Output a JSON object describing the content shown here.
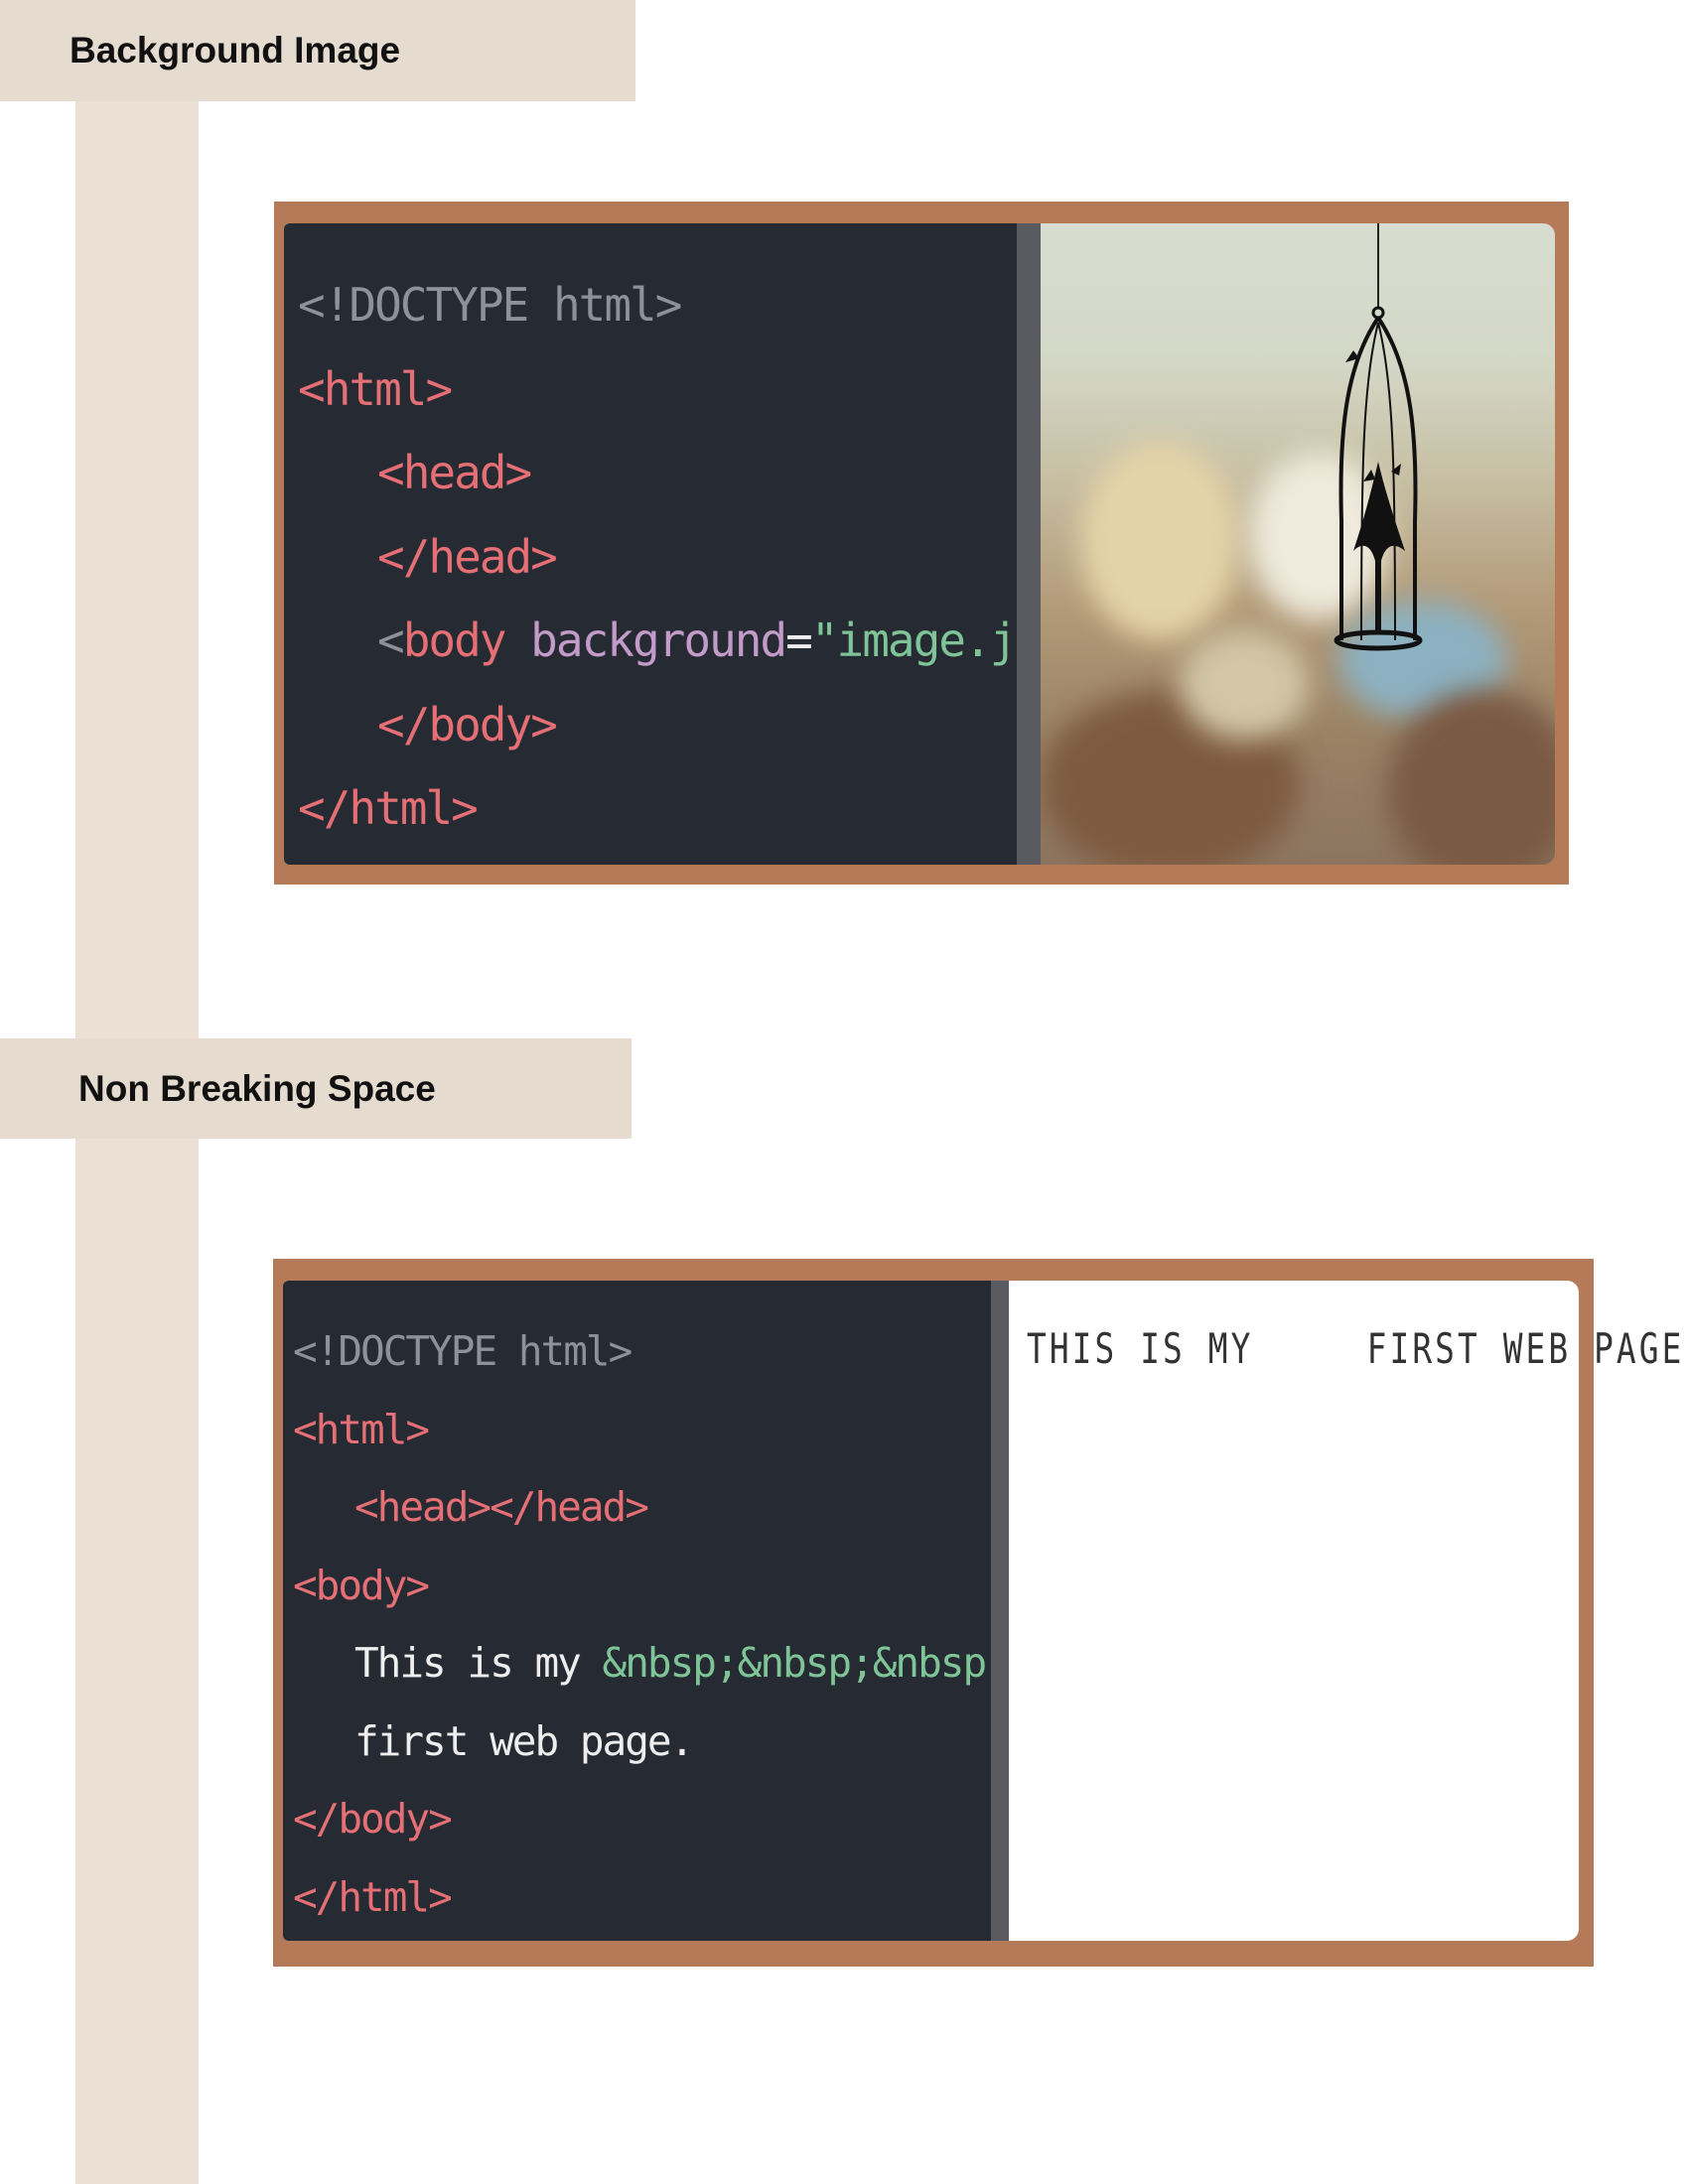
{
  "sections": [
    {
      "heading": "Background Image",
      "code": {
        "doctype": "<!DOCTYPE html>",
        "html_open": "<html>",
        "head_open": "<head>",
        "head_close": "</head>",
        "body_lt": "<",
        "body_tag": "body",
        "body_attr": " background",
        "body_eq": "=",
        "body_value": "\"image.jpg\"",
        "body_gt": ">",
        "body_close": "</body>",
        "html_close": "</html>"
      }
    },
    {
      "heading": "Non Breaking Space",
      "code": {
        "doctype": "<!DOCTYPE html>",
        "html_open": "<html>",
        "head_pair": "<head></head>",
        "body_open": "<body>",
        "text1": "This is my ",
        "nbsp": "&nbsp;&nbsp;&nbsp;&nbsp;",
        "text2": "first web page.",
        "body_close": "</body>",
        "html_close": "</html>"
      },
      "preview": "THIS IS MY     FIRST WEB PAGE."
    }
  ]
}
